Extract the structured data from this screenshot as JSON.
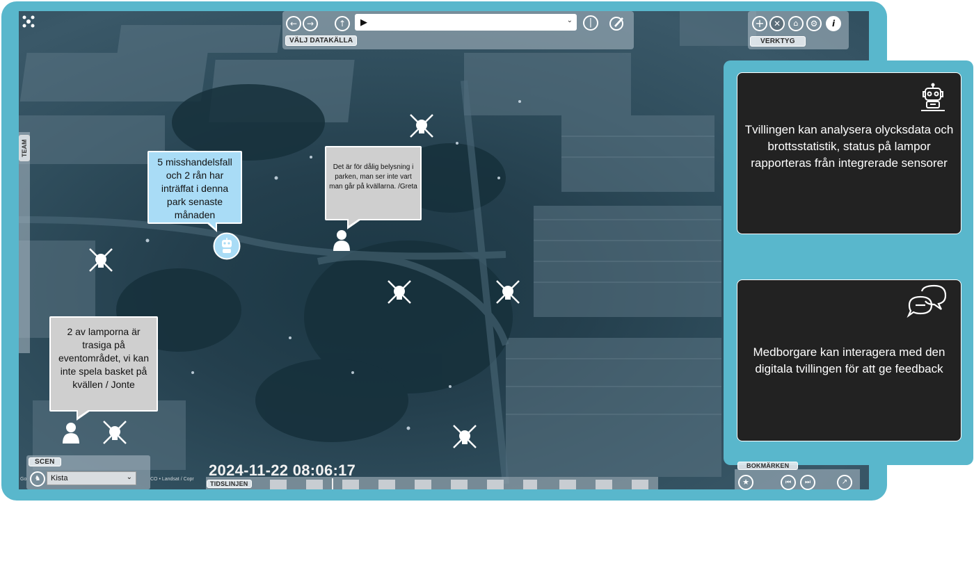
{
  "toolbar": {
    "datasource_label": "VÄLJ DATAKÄLLA",
    "datasource_value": "▶",
    "tools_label": "VERKTYG"
  },
  "team_tab": "TEAM",
  "callouts": {
    "robot_message": "5 misshandelsfall och 2 rån har inträffat i denna park senaste månaden",
    "greta_message": "Det är för dålig belysning i parken, man ser inte vart man går på kvällarna. /Greta",
    "jonte_message": "2 av lamporna är trasiga på eventområdet, vi kan inte spela basket på kvällen  / Jonte"
  },
  "scene": {
    "label": "SCEN",
    "selected": "Kista"
  },
  "timestamp": "2024-11-22 08:06:17",
  "timeline_label": "TIDSLINJEN",
  "attribution": {
    "left": "Go",
    "middle": "CO   •  Landsat / Copr"
  },
  "bookmarks_label": "BOKMÄRKEN",
  "info_cards": [
    {
      "icon": "robot-icon",
      "text": "Tvillingen kan analysera olycksdata och brottsstatistik, status på lampor rapporteras från integrerade sensorer"
    },
    {
      "icon": "chat-icon",
      "text": "Medborgare kan interagera med den digitala tvillingen för att ge feedback"
    }
  ],
  "colors": {
    "frame": "#59b7cc",
    "card_bg": "#222222",
    "callout_grey": "#cfcfcf",
    "callout_blue": "#a9dcf6"
  }
}
